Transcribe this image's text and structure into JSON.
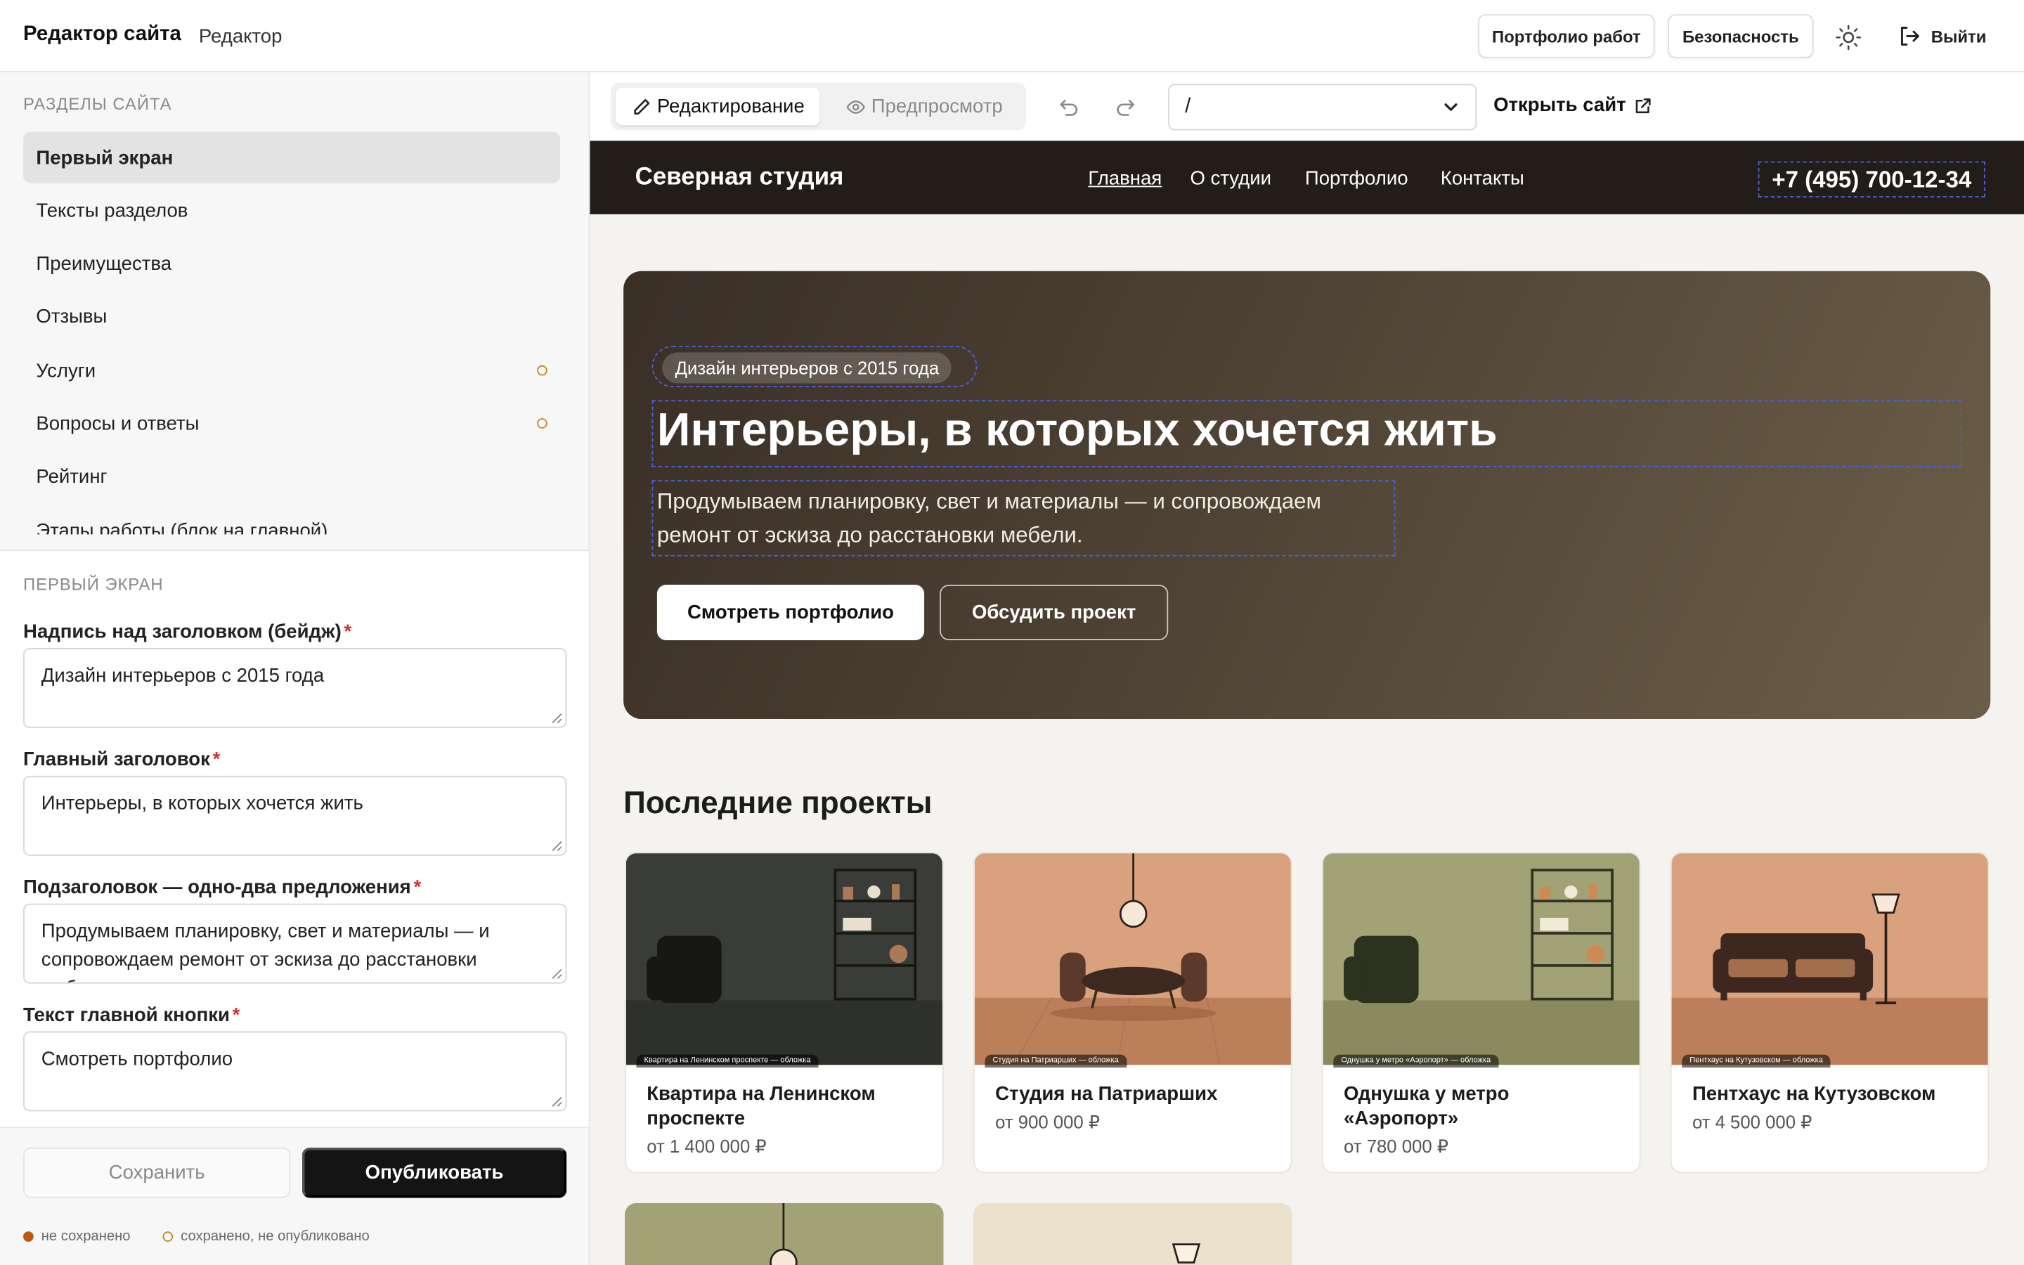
{
  "app": {
    "title": "Редактор сайта",
    "subtitle": "Редактор"
  },
  "topbar": {
    "portfolio_button": "Портфолио работ",
    "security_button": "Безопасность",
    "logout_label": "Выйти"
  },
  "sidebar": {
    "sections_title": "Разделы сайта",
    "items": [
      {
        "label": "Первый экран"
      },
      {
        "label": "Тексты разделов"
      },
      {
        "label": "Преимущества"
      },
      {
        "label": "Отзывы"
      },
      {
        "label": "Услуги"
      },
      {
        "label": "Вопросы и ответы"
      },
      {
        "label": "Рейтинг"
      },
      {
        "label": "Этапы работы (блок на главной)"
      }
    ],
    "form_title": "Первый экран",
    "fields": [
      {
        "label": "Надпись над заголовком (бейдж)",
        "value": "Дизайн интерьеров с 2015 года"
      },
      {
        "label": "Главный заголовок",
        "value": "Интерьеры, в которых хочется жить"
      },
      {
        "label": "Подзаголовок — одно-два предложения",
        "value": "Продумываем планировку, свет и материалы — и сопровождаем ремонт от эскиза до расстановки мебели."
      },
      {
        "label": "Текст главной кнопки",
        "value": "Смотреть портфолио"
      }
    ],
    "required_mark": "*",
    "save_button": "Сохранить",
    "publish_button": "Опубликовать",
    "legend_unsaved": "не сохранено",
    "legend_saved": "сохранено, не опубликовано",
    "colors": {
      "unsaved": "#b85a12",
      "saved_unpublished": "#c6861e"
    }
  },
  "toolbar": {
    "mode_edit": "Редактирование",
    "mode_preview": "Предпросмотр",
    "path_value": "/",
    "open_site": "Открыть сайт"
  },
  "preview": {
    "logo": "Северная студия",
    "nav": [
      "Главная",
      "О студии",
      "Портфолио",
      "Контакты"
    ],
    "phone": "+7 (495) 700-12-34",
    "hero": {
      "badge": "Дизайн интерьеров с 2015 года",
      "title": "Интерьеры, в которых хочется жить",
      "subtitle": "Продумываем планировку, свет и материалы — и сопровождаем ремонт от эскиза до расстановки мебели.",
      "primary_button": "Смотреть портфолио",
      "secondary_button": "Обсудить проект"
    },
    "projects_title": "Последние проекты",
    "projects": [
      {
        "title": "Квартира на Ленинском проспекте",
        "price": "от 1 400 000 ₽",
        "caption": "Квартира на Ленинском проспекте — обложка"
      },
      {
        "title": "Студия на Патриарших",
        "price": "от 900 000 ₽",
        "caption": "Студия на Патриарших — обложка"
      },
      {
        "title": "Однушка у метро «Аэропорт»",
        "price": "от 780 000 ₽",
        "caption": "Однушка у метро «Аэропорт» — обложка"
      },
      {
        "title": "Пентхаус на Кутузовском",
        "price": "от 4 500 000 ₽",
        "caption": "Пентхаус на Кутузовском — обложка"
      }
    ],
    "colors": {
      "header": "#221d19",
      "edit_outline": "#4861d8"
    }
  }
}
